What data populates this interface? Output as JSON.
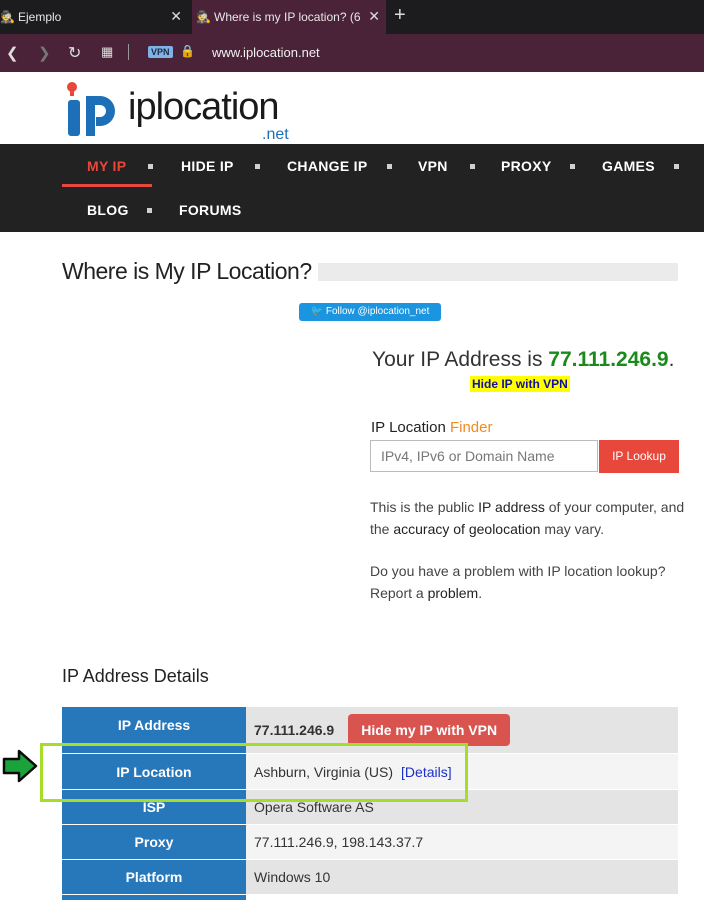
{
  "browser": {
    "tabs": [
      {
        "title": "Ejemplo",
        "icon": "incognito-icon"
      },
      {
        "title": "Where is my IP location? (6",
        "icon": "incognito-icon"
      }
    ],
    "vpn_badge": "VPN",
    "url": "www.iplocation.net"
  },
  "logo": {
    "text": "iplocation",
    "suffix": ".net"
  },
  "nav": {
    "items": [
      "MY IP",
      "HIDE IP",
      "CHANGE IP",
      "VPN",
      "PROXY",
      "GAMES",
      "BLOG",
      "FORUMS"
    ]
  },
  "page": {
    "title": "Where is My IP Location?",
    "twitter_follow": "Follow @iplocation_net",
    "your_ip_prefix": "Your IP Address is ",
    "ip": "77.111.246.9",
    "ip_suffix": ".",
    "hide_ip_vpn": "Hide IP with VPN",
    "finder_label": "IP Location ",
    "finder_label_accent": "Finder",
    "finder_placeholder": "IPv4, IPv6 or Domain Name",
    "finder_button": "IP Lookup",
    "para1": [
      "This is the public ",
      "IP address",
      " of your computer, and the ",
      "accuracy of geolocation",
      " may vary."
    ],
    "para2": [
      "Do you have a problem with IP location lookup? Report a ",
      "problem",
      "."
    ],
    "details_title": "IP Address Details"
  },
  "details_table": [
    {
      "label": "IP Address",
      "value": "77.111.246.9",
      "button": "Hide my IP with VPN"
    },
    {
      "label": "IP Location",
      "value": "Ashburn, Virginia (US)",
      "link": "[Details]"
    },
    {
      "label": "ISP",
      "value": "Opera Software AS"
    },
    {
      "label": "Proxy",
      "value": "77.111.246.9, 198.143.37.7"
    },
    {
      "label": "Platform",
      "value": "Windows 10"
    }
  ],
  "colors": {
    "accent": "#e8473b",
    "table_header": "#2777bb",
    "highlight": "#a6dc2a",
    "arrow": "#1aa33a"
  }
}
